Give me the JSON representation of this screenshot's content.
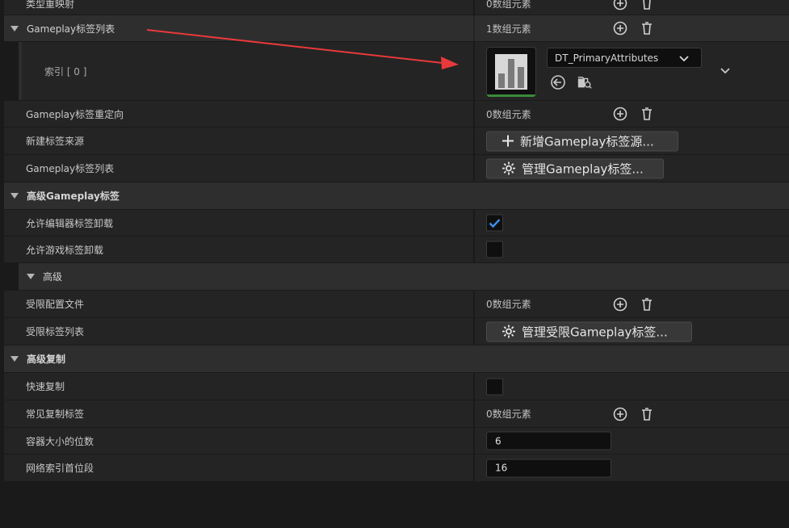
{
  "rows": {
    "type_mapping": {
      "label": "类型重映射",
      "value": "0数组元素"
    },
    "tag_list": {
      "label": "Gameplay标签列表",
      "value": "1数组元素"
    },
    "index0": {
      "label": "索引 [ 0 ]",
      "asset_name": "DT_PrimaryAttributes"
    },
    "tag_redirect": {
      "label": "Gameplay标签重定向",
      "value": "0数组元素"
    },
    "new_tag_source": {
      "label": "新建标签来源",
      "button": "新增Gameplay标签源..."
    },
    "tag_list2": {
      "label": "Gameplay标签列表",
      "button": "管理Gameplay标签..."
    },
    "adv_tags": {
      "label": "高级Gameplay标签"
    },
    "allow_editor_unload": {
      "label": "允许编辑器标签卸载",
      "checked": true
    },
    "allow_game_unload": {
      "label": "允许游戏标签卸载",
      "checked": false
    },
    "advanced": {
      "label": "高级"
    },
    "restricted_config": {
      "label": "受限配置文件",
      "value": "0数组元素"
    },
    "restricted_tag_list": {
      "label": "受限标签列表",
      "button": "管理受限Gameplay标签..."
    },
    "adv_replication": {
      "label": "高级复制"
    },
    "fast_replication": {
      "label": "快速复制",
      "checked": false
    },
    "common_rep_tags": {
      "label": "常见复制标签",
      "value": "0数组元素"
    },
    "container_bits": {
      "label": "容器大小的位数",
      "value": "6"
    },
    "net_index_first": {
      "label": "网络索引首位段",
      "value": "16"
    }
  },
  "colors": {
    "accent_arrow": "#e8393b",
    "check_blue": "#3d8ee8",
    "thumb_underline": "#3a8a3a"
  }
}
